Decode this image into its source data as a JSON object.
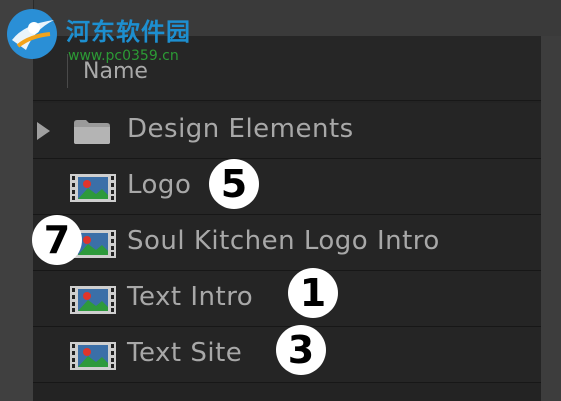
{
  "watermark": {
    "title": "河东软件园",
    "url": "www.pc0359.cn"
  },
  "panel": {
    "column_header": "Name"
  },
  "items": [
    {
      "label": "Design Elements",
      "type": "folder",
      "expandable": true
    },
    {
      "label": "Logo",
      "type": "composition",
      "badge": "5"
    },
    {
      "label": "Soul Kitchen Logo Intro",
      "type": "composition",
      "badge": "7"
    },
    {
      "label": "Text Intro",
      "type": "composition",
      "badge": "1"
    },
    {
      "label": "Text Site",
      "type": "composition",
      "badge": "3"
    }
  ],
  "colors": {
    "panel_bg": "#232323",
    "text": "#a8a8a8",
    "badge_bg": "#ffffff",
    "watermark_blue": "#1d8fd0",
    "watermark_green": "#2c9a35"
  }
}
